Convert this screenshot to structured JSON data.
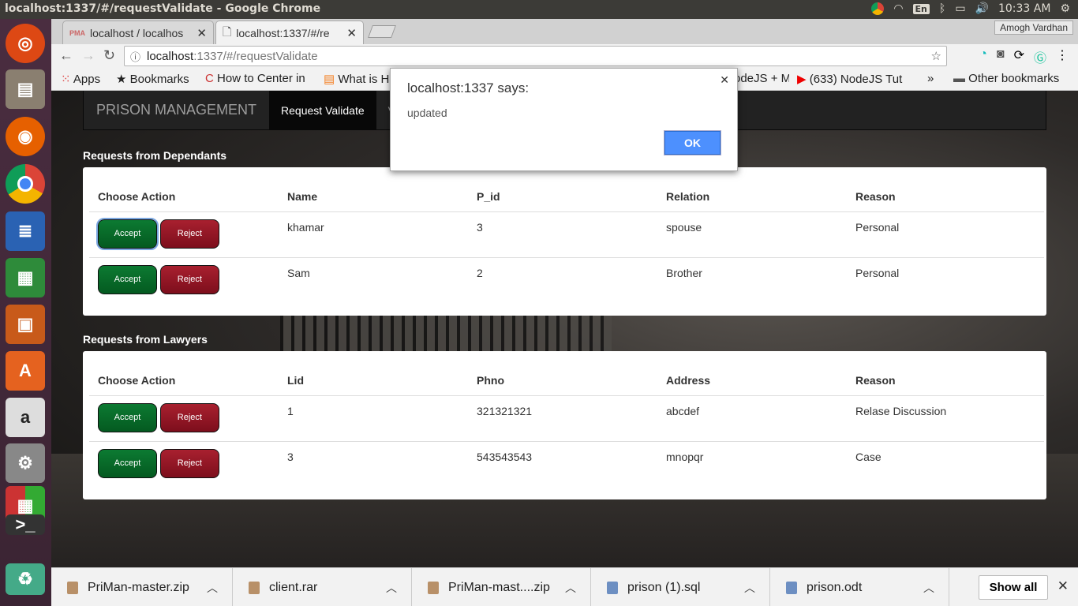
{
  "os": {
    "window_title": "localhost:1337/#/requestValidate - Google Chrome",
    "lang": "En",
    "time": "10:33 AM"
  },
  "browser": {
    "tabs": [
      {
        "label": "localhost / localhos"
      },
      {
        "label": "localhost:1337/#/re"
      }
    ],
    "profile": "Amogh Vardhan",
    "url_host": "localhost",
    "url_path": ":1337/#/requestValidate",
    "bookmarks": [
      {
        "label": "Apps"
      },
      {
        "label": "Bookmarks"
      },
      {
        "label": "How to Center in"
      },
      {
        "label": "What is H"
      },
      {
        "label": "odeJS + M"
      },
      {
        "label": "(633) NodeJS Tut"
      },
      {
        "label": "Other bookmarks"
      }
    ]
  },
  "app": {
    "brand": "PRISON MANAGEMENT",
    "nav": [
      {
        "label": "Request Validate"
      },
      {
        "label": "V"
      }
    ],
    "dependants": {
      "heading": "Requests from Dependants",
      "headers": [
        "Choose Action",
        "Name",
        "P_id",
        "Relation",
        "Reason"
      ],
      "rows": [
        [
          "khamar",
          "3",
          "spouse",
          "Personal"
        ],
        [
          "Sam",
          "2",
          "Brother",
          "Personal"
        ]
      ]
    },
    "lawyers": {
      "heading": "Requests from Lawyers",
      "headers": [
        "Choose Action",
        "Lid",
        "Phno",
        "Address",
        "Reason"
      ],
      "rows": [
        [
          "1",
          "321321321",
          "abcdef",
          "Relase Discussion"
        ],
        [
          "3",
          "543543543",
          "mnopqr",
          "Case"
        ]
      ]
    },
    "accept_label": "Accept",
    "reject_label": "Reject"
  },
  "dialog": {
    "title": "localhost:1337 says:",
    "message": "updated",
    "ok": "OK"
  },
  "downloads": {
    "items": [
      {
        "name": "PriMan-master.zip"
      },
      {
        "name": "client.rar"
      },
      {
        "name": "PriMan-mast....zip"
      },
      {
        "name": "prison (1).sql"
      },
      {
        "name": "prison.odt"
      }
    ],
    "show_all": "Show all"
  }
}
